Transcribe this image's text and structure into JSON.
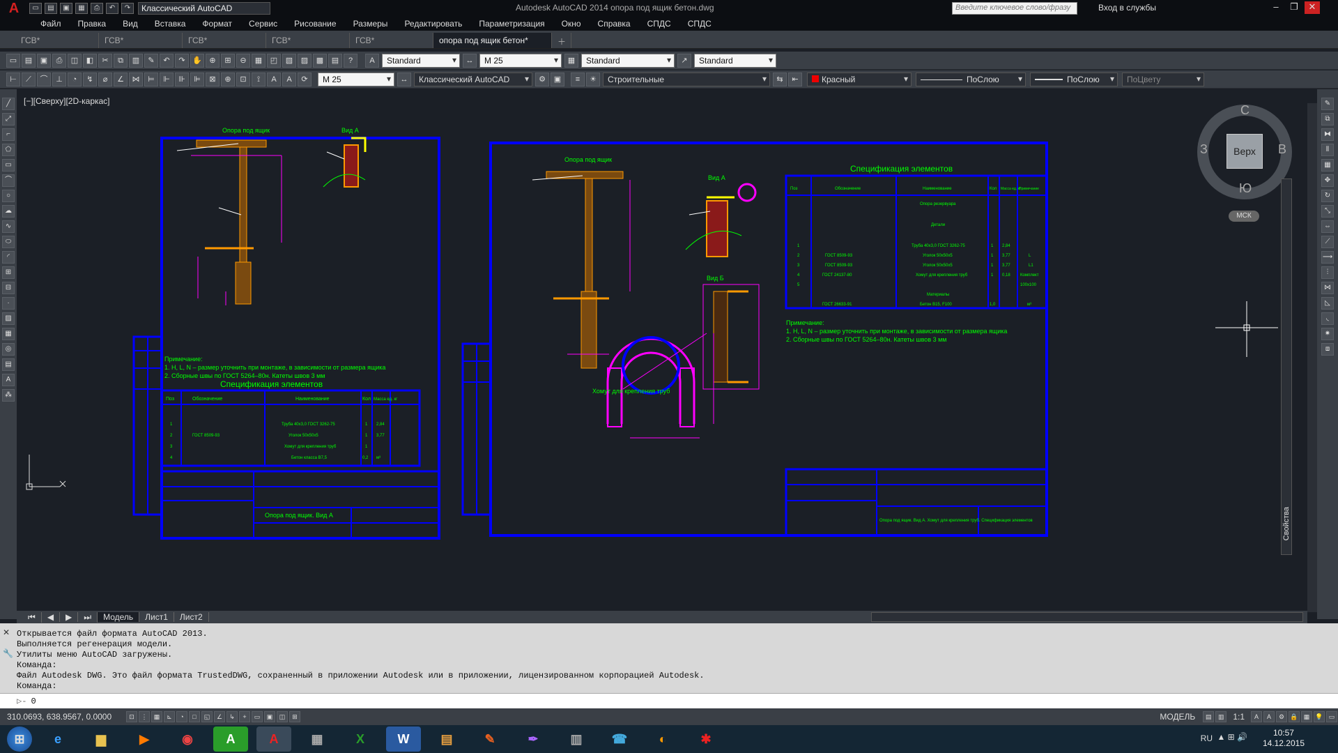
{
  "titlebar": {
    "workspace": "Классический AutoCAD",
    "app_title": "Autodesk AutoCAD 2014    опора под ящик бетон.dwg",
    "search_placeholder": "Введите ключевое слово/фразу",
    "login": "Вход в службы"
  },
  "menu": [
    "Файл",
    "Правка",
    "Вид",
    "Вставка",
    "Формат",
    "Сервис",
    "Рисование",
    "Размеры",
    "Редактировать",
    "Параметризация",
    "Окно",
    "Справка",
    "СПДС",
    "СПДС"
  ],
  "doc_tabs": [
    "ГСВ*",
    "ГСВ*",
    "ГСВ*",
    "ГСВ*",
    "ГСВ*",
    "опора под ящик бетон*"
  ],
  "toolbar1": {
    "text_style": "Standard",
    "dim_style": "M 25",
    "table_style": "Standard",
    "mleader_style": "Standard"
  },
  "toolbar2": {
    "dim_scale": "M 25",
    "workspace": "Классический AutoCAD",
    "layer": "Строительные",
    "color": "Красный",
    "linetype": "ПоСлою",
    "lineweight": "ПоСлою",
    "plotstyle": "ПоЦвету"
  },
  "viewport_label": "[−][Сверху][2D-каркас]",
  "viewcube": {
    "top": "Верх",
    "n": "С",
    "s": "Ю",
    "w": "З",
    "e": "В",
    "ucs": "МСК"
  },
  "properties_palette": "Свойства",
  "layout_tabs": [
    "Модель",
    "Лист1",
    "Лист2"
  ],
  "drawing": {
    "sheet1": {
      "title_left": "Опора под ящик",
      "view_a": "Вид А",
      "notes": [
        "Примечание:",
        "1. Н, L, N – размер уточнить при монтаже, в зависимости от размера ящика",
        "2. Сборные швы по ГОСТ 5264–80н. Катеты швов 3 мм"
      ],
      "spec_title": "Спецификация элементов",
      "spec_headers": [
        "Поз",
        "Обозначение",
        "Наименование",
        "Кол",
        "Масса ед. кг"
      ],
      "spec_rows": [
        [
          "1",
          "",
          "Труба 40х3,0 ГОСТ 3262-75",
          "1",
          "2,84"
        ],
        [
          "2",
          "ГОСТ 8509-93",
          "Уголок 50х50х5",
          "1",
          "3,77"
        ],
        [
          "3",
          "",
          "Хомут для крепления труб",
          "1",
          ""
        ],
        [
          "4",
          "",
          "Бетон класса B7,5",
          "0,2",
          "м³"
        ]
      ],
      "sheet_name": "Опора под ящик. Вид А"
    },
    "sheet2": {
      "title": "Опора под ящик",
      "view_a": "Вид А",
      "view_b": "Вид Б",
      "clamp_title": "Хомут для крепления труб",
      "spec_title": "Спецификация элементов",
      "spec_headers": [
        "Поз",
        "Обозначение",
        "Наименование",
        "Кол",
        "Масса ед. кг",
        "Примечание"
      ],
      "spec_rows": [
        [
          "",
          "",
          "Опора резервуара",
          "",
          "",
          ""
        ],
        [
          "",
          "",
          "Детали",
          "",
          "",
          ""
        ],
        [
          "1",
          "",
          "Труба 40х3,0 ГОСТ 3262-75",
          "1",
          "2,84",
          ""
        ],
        [
          "2",
          "ГОСТ 8509-93",
          "Уголок 50х50х5",
          "1",
          "3,77",
          "L"
        ],
        [
          "3",
          "ГОСТ 8509-93",
          "Уголок 50х50х5",
          "1",
          "3,77",
          "L1"
        ],
        [
          "4",
          "ГОСТ 24137-80",
          "Хомут для крепления труб",
          "1",
          "0,18",
          "Комплект"
        ],
        [
          "5",
          "",
          "",
          "",
          "",
          "100х100"
        ],
        [
          "",
          "",
          "Материалы",
          "",
          "",
          ""
        ],
        [
          "",
          "ГОСТ 26633-91",
          "Бетон B15, F100",
          "1,0",
          "",
          "м³"
        ]
      ],
      "notes": [
        "Примечание:",
        "1. Н, L, N – размер уточнить при монтаже, в зависимости от размера ящика",
        "2. Сборные швы по ГОСТ 5264–80н. Катеты швов 3 мм"
      ],
      "sheet_name": "Опора под ящик. Вид А. Хомут для крепления труб. Спецификация элементов"
    }
  },
  "command_history": [
    "Открывается файл формата AutoCAD 2013.",
    "Выполняется регенерация модели.",
    "Утилиты меню AutoCAD загружены.",
    "Команда:",
    "Файл Autodesk DWG. Это файл формата TrustedDWG, сохраненный в приложении Autodesk или в приложении, лицензированном корпорацией Autodesk.",
    "Команда:"
  ],
  "command_input": "0",
  "status": {
    "coords": "310.0693, 638.9567, 0.0000",
    "mode": "МОДЕЛЬ",
    "scale": "1:1"
  },
  "taskbar": {
    "lang": "RU",
    "time": "10:57",
    "date": "14.12.2015"
  },
  "colors": {
    "frame": "#0000ff",
    "green": "#00ff00",
    "orange": "#ff9900",
    "magenta": "#ff00ff",
    "yellow": "#ffff00",
    "canvas": "#1b1f26"
  }
}
